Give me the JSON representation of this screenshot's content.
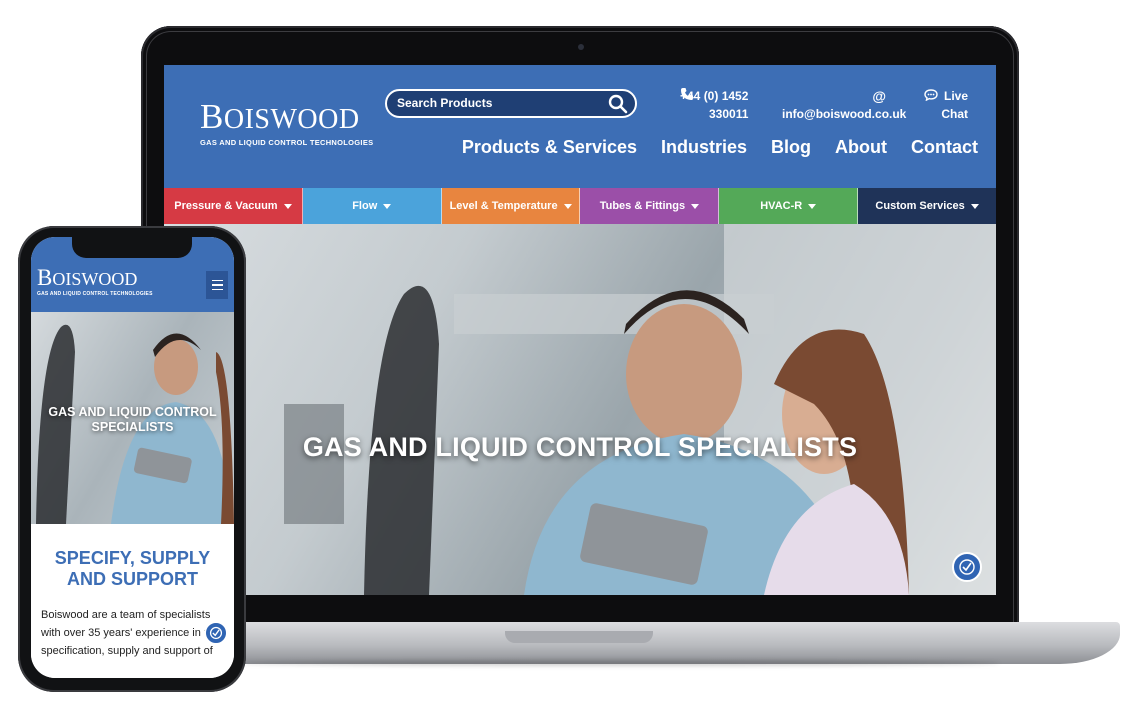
{
  "desktop": {
    "logo": {
      "word": "Boiswood",
      "tagline": "GAS AND LIQUID CONTROL TECHNOLOGIES"
    },
    "search": {
      "placeholder": "Search Products"
    },
    "contact": {
      "phone": "+44 (0) 1452\n330011",
      "email": "info@boiswood.co.uk",
      "chat": "Live\nChat"
    },
    "nav": [
      "Products & Services",
      "Industries",
      "Blog",
      "About",
      "Contact"
    ],
    "categories": [
      {
        "label": "Pressure & Vacuum",
        "color": "#d63a44"
      },
      {
        "label": "Flow",
        "color": "#4ba3db"
      },
      {
        "label": "Level & Temperature",
        "color": "#e8853f"
      },
      {
        "label": "Tubes & Fittings",
        "color": "#9b4fa8"
      },
      {
        "label": "HVAC-R",
        "color": "#54a958"
      },
      {
        "label": "Custom Services",
        "color": "#1f3358"
      }
    ],
    "hero_title": "GAS AND LIQUID CONTROL SPECIALISTS"
  },
  "mobile": {
    "logo": {
      "word": "Boiswood",
      "tagline": "GAS AND LIQUID CONTROL TECHNOLOGIES"
    },
    "hero_title": "GAS AND LIQUID CONTROL\nSPECIALISTS",
    "heading": "SPECIFY, SUPPLY\nAND SUPPORT",
    "body": "Boiswood are a team of specialists with over 35 years' experience in the specification, supply and support of"
  },
  "colors": {
    "brand_blue": "#3d6eb5",
    "search_fill": "#1f3f74"
  },
  "icons": [
    "search-icon",
    "phone-icon",
    "email-icon",
    "chat-icon",
    "menu-icon",
    "accessibility-icon"
  ]
}
